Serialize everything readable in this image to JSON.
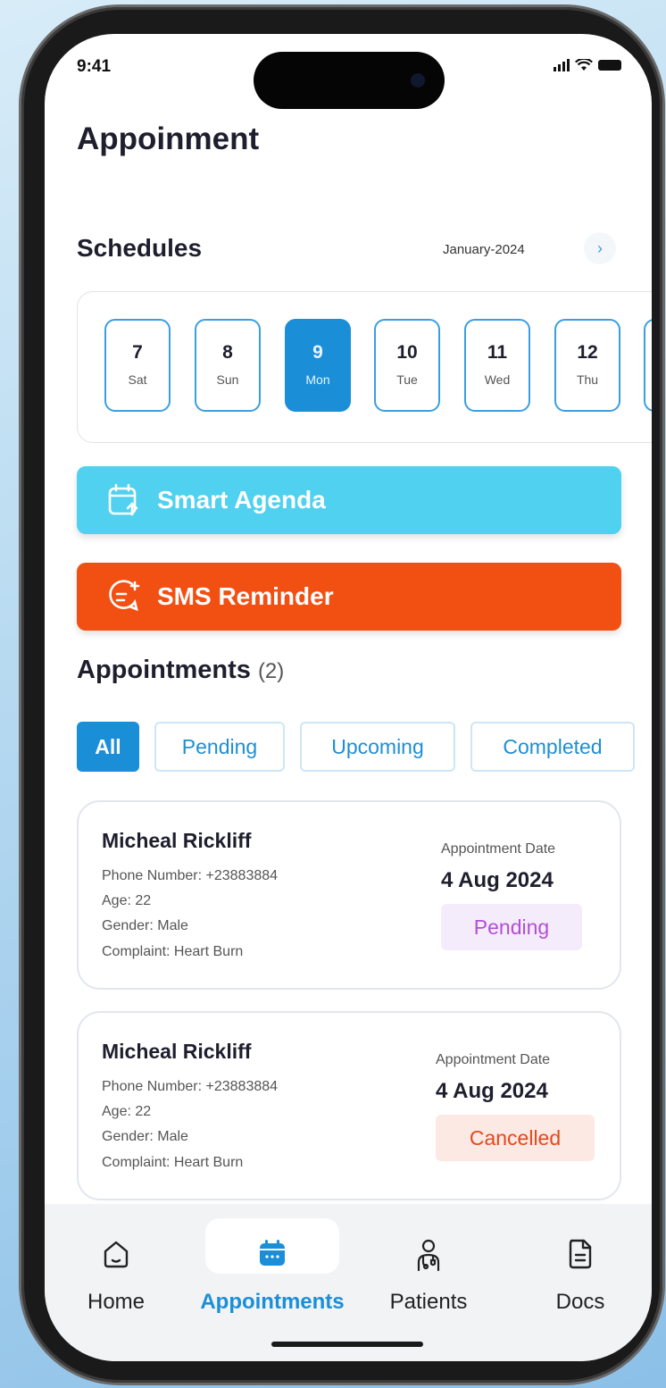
{
  "status": {
    "time": "9:41"
  },
  "page": {
    "title": "Appoinment"
  },
  "schedule": {
    "title": "Schedules",
    "month": "January-2024",
    "days": [
      {
        "num": "7",
        "weekday": "Sat"
      },
      {
        "num": "8",
        "weekday": "Sun"
      },
      {
        "num": "9",
        "weekday": "Mon"
      },
      {
        "num": "10",
        "weekday": "Tue"
      },
      {
        "num": "11",
        "weekday": "Wed"
      },
      {
        "num": "12",
        "weekday": "Thu"
      }
    ],
    "selected_day": "9"
  },
  "actions": {
    "smart_agenda": "Smart Agenda",
    "sms_reminder": "SMS Reminder"
  },
  "appointments": {
    "title": "Appointments",
    "count": "(2)",
    "filters": [
      "All",
      "Pending",
      "Upcoming",
      "Completed"
    ],
    "active_filter": "All",
    "items": [
      {
        "name": "Micheal Rickliff",
        "phone": "Phone Number: +23883884",
        "age": "Age: 22",
        "gender": "Gender: Male",
        "complaint": "Complaint: Heart Burn",
        "date_label": "Appointment Date",
        "date": "4 Aug 2024",
        "status": "Pending"
      },
      {
        "name": "Micheal Rickliff",
        "phone": "Phone Number: +23883884",
        "age": "Age: 22",
        "gender": "Gender: Male",
        "complaint": "Complaint: Heart Burn",
        "date_label": "Appointment Date",
        "date": "4 Aug 2024",
        "status": "Cancelled"
      }
    ]
  },
  "tabbar": {
    "items": [
      {
        "label": "Home",
        "icon": "home-icon"
      },
      {
        "label": "Appointments",
        "icon": "calendar-icon"
      },
      {
        "label": "Patients",
        "icon": "patient-icon"
      },
      {
        "label": "Docs",
        "icon": "document-icon"
      }
    ],
    "active": "Appointments"
  },
  "colors": {
    "primary": "#1a8fd8",
    "agenda": "#4fd1ef",
    "sms": "#f24f12",
    "pending": "#b14fd6",
    "cancelled": "#e24a1c"
  }
}
